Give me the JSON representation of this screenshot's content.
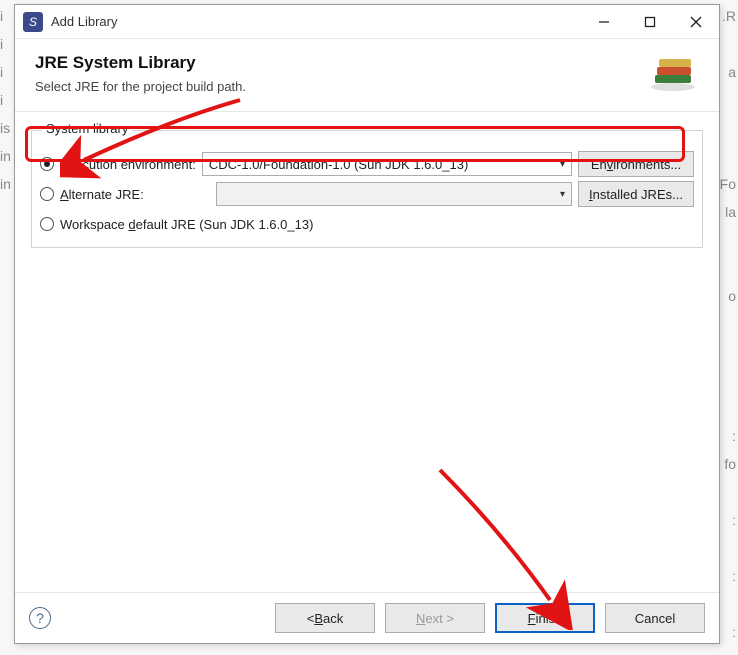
{
  "titlebar": {
    "title": "Add Library"
  },
  "banner": {
    "heading": "JRE System Library",
    "subhead": "Select JRE for the project build path."
  },
  "group": {
    "legend": "System library",
    "exec_env": {
      "label_pre": "",
      "label_mn": "E",
      "label_post": "xecution environment:",
      "selected": "CDC-1.0/Foundation-1.0 (Sun JDK 1.6.0_13)",
      "btn_pre": "En",
      "btn_mn": "v",
      "btn_post": "ironments..."
    },
    "alt_jre": {
      "label_pre": "",
      "label_mn": "A",
      "label_post": "lternate JRE:",
      "btn_pre": "",
      "btn_mn": "I",
      "btn_post": "nstalled JREs..."
    },
    "ws_default": {
      "label_pre": "Workspace ",
      "label_mn": "d",
      "label_post": "efault JRE (Sun JDK 1.6.0_13)"
    }
  },
  "buttons": {
    "back_pre": "< ",
    "back_mn": "B",
    "back_post": "ack",
    "next_pre": "",
    "next_mn": "N",
    "next_post": "ext >",
    "finish_pre": "",
    "finish_mn": "F",
    "finish_post": "inish",
    "cancel": "Cancel"
  },
  "bg_left_text": "i\ni\ni\ni\nis\nin\nin",
  "bg_right_text": ".R\n\na\n\n\n\nFo\nla\n\n\no\n\n\n\n\n:\nfo\n\n:\n\n:\n\n:"
}
